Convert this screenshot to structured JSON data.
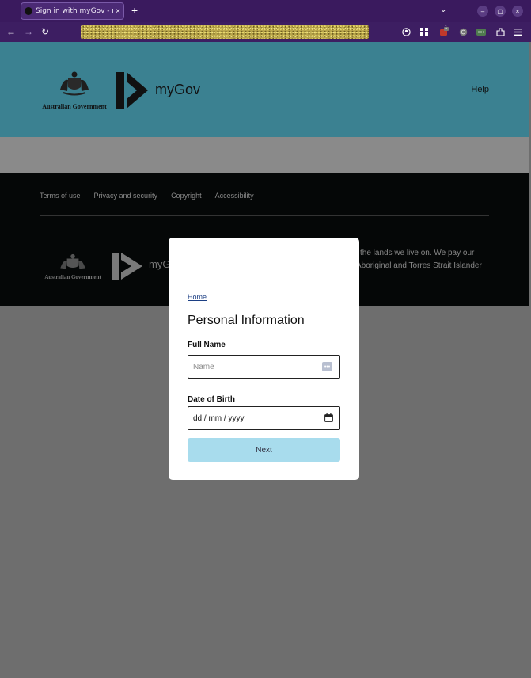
{
  "browser": {
    "tab_title": "Sign in with myGov - myG",
    "tab_close": "×",
    "new_tab": "+",
    "tab_menu": "⌄",
    "window_controls": [
      "–",
      "▢",
      "×"
    ],
    "nav": {
      "back": "←",
      "forward": "→",
      "reload": "↻"
    },
    "extensions": [
      "account-icon",
      "grid-icon",
      "extension-badge-icon",
      "shield-icon",
      "password-icon",
      "puzzle-icon",
      "menu-icon"
    ],
    "extension_badge_count": "1"
  },
  "header": {
    "govt_name": "Australian Government",
    "brand": "myGov",
    "help_link": "Help"
  },
  "footer": {
    "links": [
      "Terms of use",
      "Privacy and security",
      "Copyright",
      "Accessibility"
    ],
    "govt_name": "Australian Government",
    "brand_partial": "myG",
    "acknowledgement_line1": "the lands we live on. We pay our",
    "acknowledgement_line2": "Aboriginal and Torres Strait Islander"
  },
  "modal": {
    "breadcrumb": "Home",
    "title": "Personal Information",
    "full_name_label": "Full Name",
    "full_name_placeholder": "Name",
    "full_name_value": "",
    "dob_label": "Date of Birth",
    "dob_placeholder": "dd / mm / yyyy",
    "next_label": "Next"
  },
  "colors": {
    "chrome": "#3a1a5e",
    "hero": "#3b8191",
    "button": "#a8dced",
    "link": "#1c3f84"
  }
}
